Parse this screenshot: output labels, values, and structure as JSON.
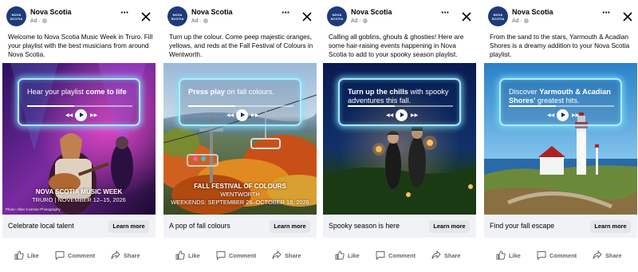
{
  "page": {
    "name": "Nova Scotia",
    "logo_text": "NOVA SCOTIA",
    "ad_label": "Ad ·",
    "globe_icon": "globe-icon"
  },
  "icons": {
    "more": "more-dots-icon",
    "close": "close-icon",
    "like": "thumbs-up-icon",
    "comment": "comment-icon",
    "share": "share-arrow-icon",
    "play": "play-icon",
    "prev": "previous-icon",
    "next": "next-icon"
  },
  "actions": {
    "like_label": "Like",
    "comment_label": "Comment",
    "share_label": "Share",
    "learn_more_label": "Learn more"
  },
  "ads": [
    {
      "caption": "Welcome to Nova Scotia Music Week in Truro. Fill your playlist with the best musicians from around Nova Scotia.",
      "player_text_normal": "Hear your playlist ",
      "player_text_bold": "come to life",
      "overlay_title": "NOVA SCOTIA MUSIC WEEK",
      "overlay_sub": "TRURO | NOVEMBER 12–15, 2026",
      "credit": "Photo: Allan Cosman Photography",
      "headline": "Celebrate local talent"
    },
    {
      "caption": "Turn up the colour. Come peep majestic oranges, yellows, and reds at the Fall Festival of Colours in Wentworth.",
      "player_text_bold": "Press play",
      "player_text_normal": " on fall colours.",
      "overlay_title": "FALL FESTIVAL OF COLOURS",
      "overlay_sub": "WENTWORTH",
      "overlay_sub2": "WEEKENDS: SEPTEMBER 26–OCTOBER 18, 2026",
      "headline": "A pop of fall colours"
    },
    {
      "caption": "Calling all goblins, ghouls & ghosties! Here are some hair-raising events happening in Nova Scotia to add to your spooky season playlist.",
      "player_text_bold": "Turn up the chills",
      "player_text_normal": " with spooky adventures this fall.",
      "headline": "Spooky season is here"
    },
    {
      "caption": "From the sand to the stars, Yarmouth & Acadian Shores is a dreamy addition to your Nova Scotia playlist.",
      "player_text_normal": "Discover ",
      "player_text_bold": "Yarmouth & Acadian Shores'",
      "player_text_tail": " greatest hits.",
      "headline": "Find your fall escape"
    }
  ],
  "colors": {
    "brand_navy": "#1f3a7a",
    "neon_glow": "#8ee8ff",
    "text_secondary": "#65676b",
    "cta_bg": "#f0f2f5",
    "button_bg": "#e4e6eb"
  }
}
